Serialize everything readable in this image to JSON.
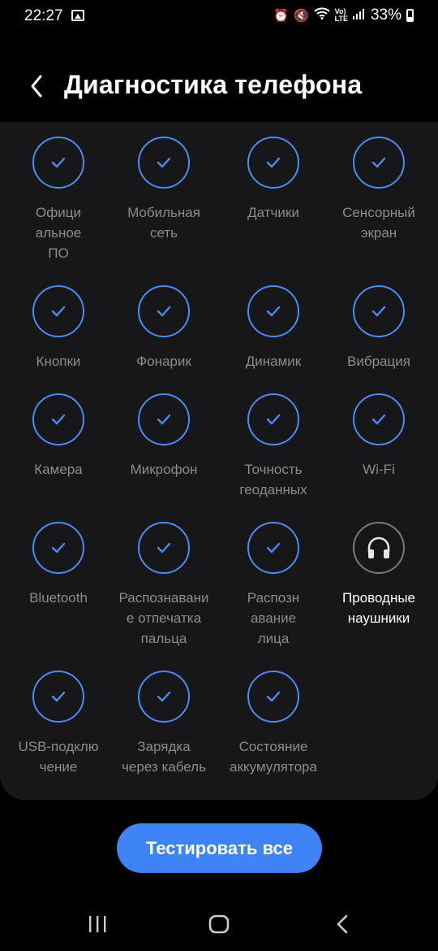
{
  "status": {
    "time": "22:27",
    "battery": "33%"
  },
  "header": {
    "title": "Диагностика телефона"
  },
  "tiles": [
    {
      "label": "Офици\nальное\nПО",
      "state": "passed"
    },
    {
      "label": "Мобильная\nсеть",
      "state": "passed"
    },
    {
      "label": "Датчики",
      "state": "passed"
    },
    {
      "label": "Сенсорный\nэкран",
      "state": "passed"
    },
    {
      "label": "Кнопки",
      "state": "passed"
    },
    {
      "label": "Фонарик",
      "state": "passed"
    },
    {
      "label": "Динамик",
      "state": "passed"
    },
    {
      "label": "Вибрация",
      "state": "passed"
    },
    {
      "label": "Камера",
      "state": "passed"
    },
    {
      "label": "Микрофон",
      "state": "passed"
    },
    {
      "label": "Точность\nгеоданных",
      "state": "passed"
    },
    {
      "label": "Wi-Fi",
      "state": "passed"
    },
    {
      "label": "Bluetooth",
      "state": "passed"
    },
    {
      "label": "Распознавани\nе отпечатка\nпальца",
      "state": "passed"
    },
    {
      "label": "Распозн\nавание\nлица",
      "state": "passed"
    },
    {
      "label": "Проводные\nнаушники",
      "state": "untested",
      "icon": "headphones-icon"
    },
    {
      "label": "USB-подклю\nчение",
      "state": "passed"
    },
    {
      "label": "Зарядка\nчерез кабель",
      "state": "passed"
    },
    {
      "label": "Состояние\nаккумулятора",
      "state": "passed"
    }
  ],
  "actions": {
    "test_all_label": "Тестировать все"
  },
  "colors": {
    "accent": "#3e84f6",
    "check": "#4a8bf5",
    "panel": "#17171a",
    "label": "#8b8b90"
  }
}
